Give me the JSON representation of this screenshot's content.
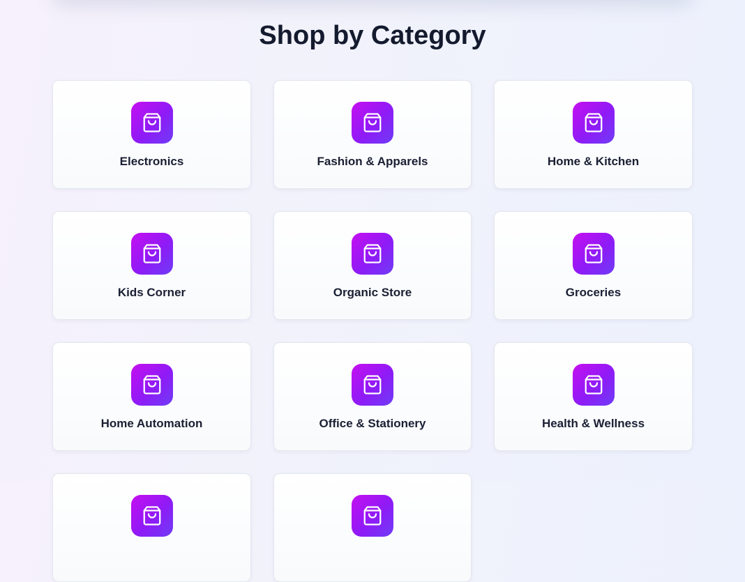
{
  "section": {
    "title": "Shop by Category"
  },
  "categories": [
    {
      "label": "Electronics",
      "icon": "shopping-bag-icon"
    },
    {
      "label": "Fashion & Apparels",
      "icon": "shopping-bag-icon"
    },
    {
      "label": "Home & Kitchen",
      "icon": "shopping-bag-icon"
    },
    {
      "label": "Kids Corner",
      "icon": "shopping-bag-icon"
    },
    {
      "label": "Organic Store",
      "icon": "shopping-bag-icon"
    },
    {
      "label": "Groceries",
      "icon": "shopping-bag-icon"
    },
    {
      "label": "Home Automation",
      "icon": "shopping-bag-icon"
    },
    {
      "label": "Office & Stationery",
      "icon": "shopping-bag-icon"
    },
    {
      "label": "Health & Wellness",
      "icon": "shopping-bag-icon"
    },
    {
      "label": "",
      "icon": "shopping-bag-icon"
    },
    {
      "label": "",
      "icon": "shopping-bag-icon"
    }
  ],
  "colors": {
    "icon_gradient_start": "#c60ff0",
    "icon_gradient_end": "#6f3cf6",
    "title_text": "#141b2e"
  }
}
